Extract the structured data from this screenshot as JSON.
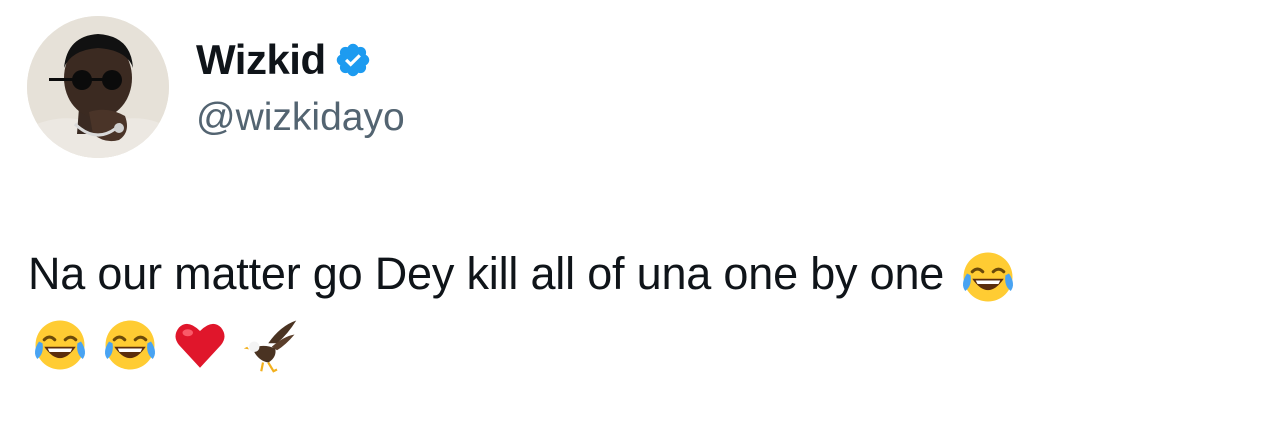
{
  "tweet": {
    "display_name": "Wizkid",
    "handle": "@wizkidayo",
    "verified": true,
    "text": "Na our matter go Dey kill all of una one by one",
    "emojis_line1": [
      "face-with-tears-of-joy"
    ],
    "emojis_line2": [
      "face-with-tears-of-joy",
      "face-with-tears-of-joy",
      "red-heart",
      "eagle"
    ]
  },
  "colors": {
    "verified_badge": "#1d9bf0",
    "handle": "#536471",
    "text": "#0f1419"
  }
}
